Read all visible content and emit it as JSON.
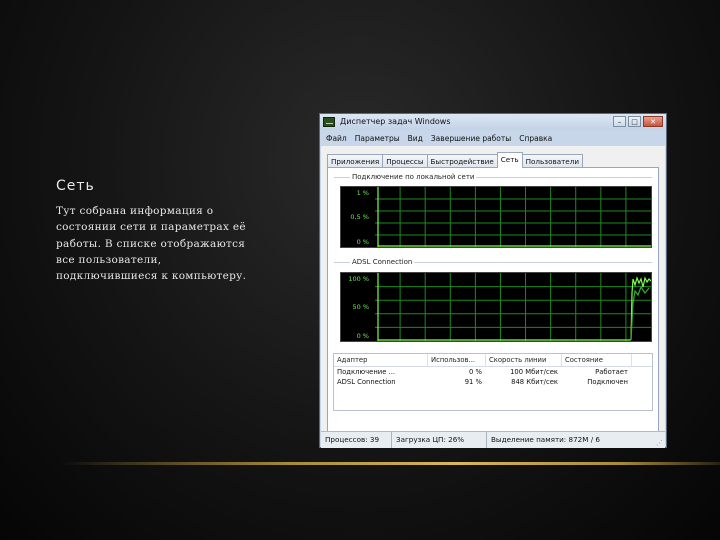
{
  "slide": {
    "title": "Сеть",
    "body": "Тут собрана информация о\nсостоянии сети и параметрах её\nработы. В списке отображаются\nвсе пользователи,\nподключившиеся к компьютеру."
  },
  "window": {
    "title": "Диспетчер задач Windows",
    "buttons": {
      "minimize": "–",
      "maximize": "□",
      "close": "✕"
    },
    "menu": [
      "Файл",
      "Параметры",
      "Вид",
      "Завершение работы",
      "Справка"
    ],
    "tabs": [
      "Приложения",
      "Процессы",
      "Быстродействие",
      "Сеть",
      "Пользователи"
    ],
    "active_tab": "Сеть",
    "graph1": {
      "label": "Подключение по локальной сети",
      "ticks": [
        "1 %",
        "0,5 %",
        "0 %"
      ]
    },
    "graph2": {
      "label": "ADSL Connection",
      "ticks": [
        "100 %",
        "50 %",
        "0 %"
      ]
    },
    "table": {
      "columns": [
        "Адаптер",
        "Использов...",
        "Скорость линии",
        "Состояние"
      ],
      "rows": [
        [
          "Подключение ...",
          "0 %",
          "100 Мбит/сек",
          "Работает"
        ],
        [
          "ADSL Connection",
          "91 %",
          "848 Кбит/сек",
          "Подключен"
        ]
      ]
    },
    "status": {
      "processes": "Процессов: 39",
      "cpu": "Загрузка ЦП: 26%",
      "memory": "Выделение памяти: 872M / 6"
    },
    "colors": {
      "graph_grid": "#1e8a1e",
      "graph_line": "#7cff4a",
      "axis_text": "#6fe85a"
    }
  }
}
